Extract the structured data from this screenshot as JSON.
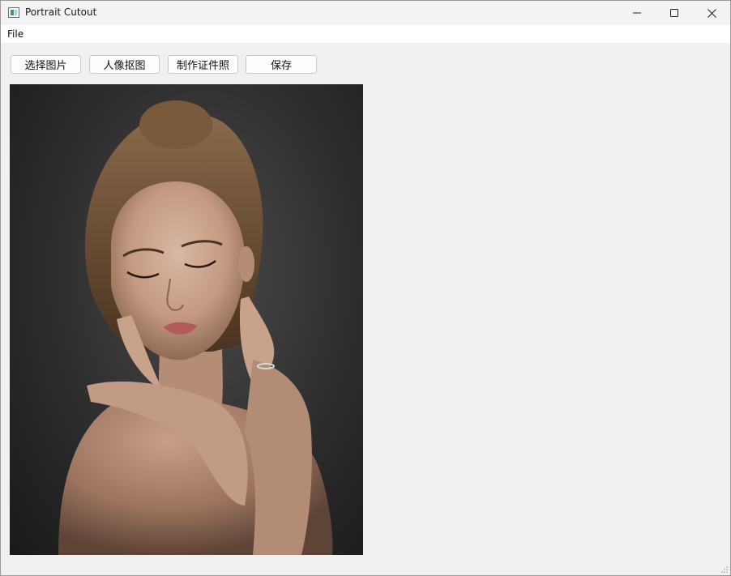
{
  "window": {
    "title": "Portrait Cutout",
    "icon": "app-window-icon",
    "controls": [
      "minimize-icon",
      "maximize-icon",
      "close-icon"
    ]
  },
  "menubar": {
    "items": [
      {
        "label": "File"
      }
    ]
  },
  "toolbar": {
    "select_image_label": "选择图片",
    "portrait_cutout_label": "人像抠图",
    "make_id_photo_label": "制作证件照",
    "save_label": "保存"
  },
  "image_view": {
    "content": "portrait photo of a woman with hair in a bun, hands crossed near face, dark gray background"
  },
  "colors": {
    "window_bg": "#f0f0f0",
    "titlebar_bg": "#f3f3f3",
    "menubar_bg": "#ffffff",
    "button_bg": "#fdfdfd",
    "button_border": "#c9c9c9"
  }
}
